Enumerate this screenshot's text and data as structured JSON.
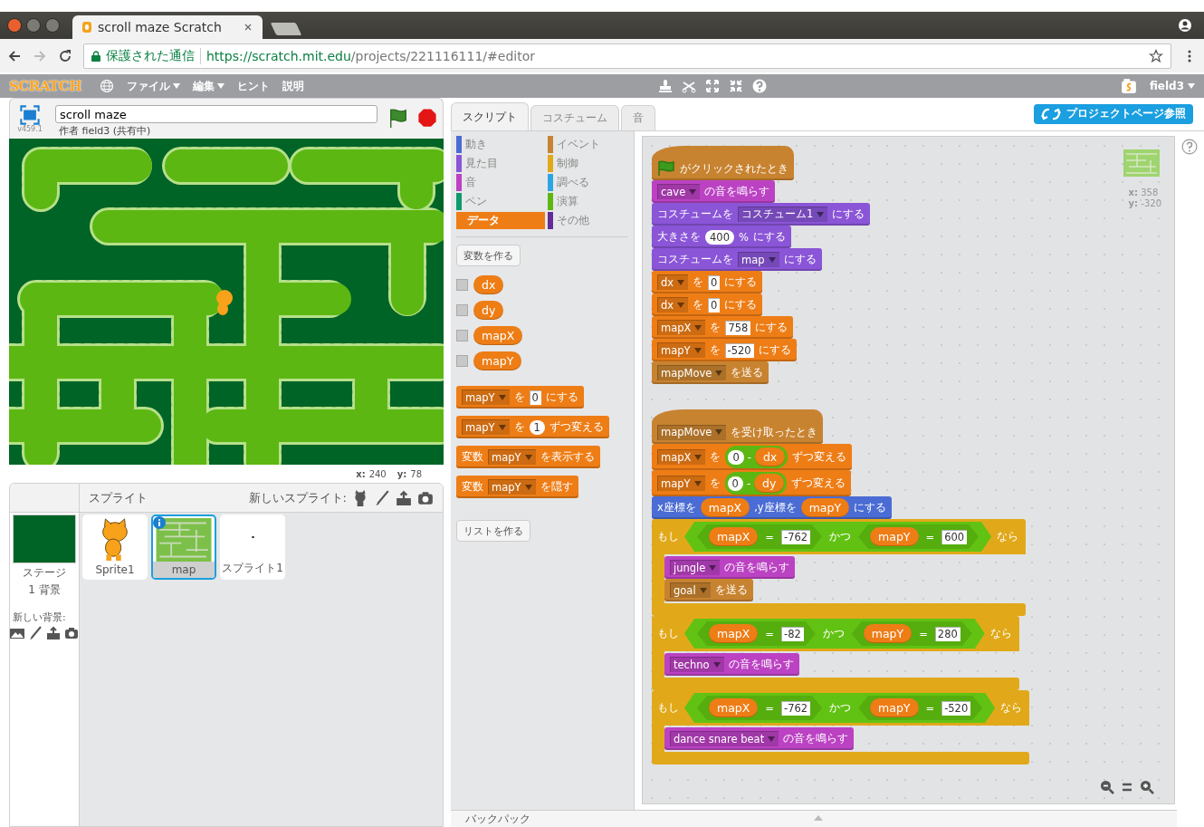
{
  "browser": {
    "tab_title": "scroll maze Scratch",
    "security_label": "保護された通信",
    "url_host": "https://scratch.mit.edu",
    "url_path": "/projects/221116111/#editor"
  },
  "menu_bar": {
    "logo": "SCRATCH",
    "items": [
      {
        "label": "ファイル",
        "has_menu": true
      },
      {
        "label": "編集",
        "has_menu": true
      },
      {
        "label": "ヒント",
        "has_menu": false
      },
      {
        "label": "説明",
        "has_menu": false
      }
    ],
    "user": "field3"
  },
  "stage": {
    "version": "v459.1",
    "title": "scroll maze",
    "author": "作者 field3 (共有中)",
    "x_label": "x:",
    "x_value": "240",
    "y_label": "y:",
    "y_value": "78"
  },
  "sprites_pane": {
    "title": "スプライト",
    "new_sprite_label": "新しいスプライト:",
    "stage_label": "ステージ",
    "backdrop_count": "1 背景",
    "new_backdrop_label": "新しい背景:",
    "sprites": [
      {
        "name": "Sprite1",
        "kind": "character",
        "selected": false
      },
      {
        "name": "map",
        "kind": "maze",
        "selected": true
      },
      {
        "name": "スプライト1",
        "kind": "dot",
        "selected": false
      }
    ]
  },
  "editor_tabs": [
    {
      "label": "スクリプト",
      "selected": true
    },
    {
      "label": "コスチューム",
      "selected": false
    },
    {
      "label": "音",
      "selected": false
    }
  ],
  "project_page_button": "プロジェクトページ参照",
  "categories": [
    {
      "label": "動き",
      "color": "#4a6cd4",
      "selected": false
    },
    {
      "label": "見た目",
      "color": "#8a55d7",
      "selected": false
    },
    {
      "label": "音",
      "color": "#bb42c3",
      "selected": false
    },
    {
      "label": "ペン",
      "color": "#0e9a6c",
      "selected": false
    },
    {
      "label": "データ",
      "color": "#ee7d16",
      "selected": true
    },
    {
      "label": "イベント",
      "color": "#c88330",
      "selected": false
    },
    {
      "label": "制御",
      "color": "#e1a91a",
      "selected": false
    },
    {
      "label": "調べる",
      "color": "#2ca5e2",
      "selected": false
    },
    {
      "label": "演算",
      "color": "#5cb712",
      "selected": false
    },
    {
      "label": "その他",
      "color": "#632d99",
      "selected": false
    }
  ],
  "palette": {
    "make_variable": "変数を作る",
    "variables": [
      {
        "name": "dx",
        "checked": false
      },
      {
        "name": "dy",
        "checked": false
      },
      {
        "name": "mapX",
        "checked": false
      },
      {
        "name": "mapY",
        "checked": false
      }
    ],
    "blocks": [
      {
        "kind": "data",
        "parts": [
          {
            "kind": "dropdown",
            "text": "mapY"
          },
          {
            "kind": "text",
            "text": "を"
          },
          {
            "kind": "number",
            "text": "0"
          },
          {
            "kind": "text",
            "text": "にする"
          }
        ]
      },
      {
        "kind": "data",
        "parts": [
          {
            "kind": "dropdown",
            "text": "mapY"
          },
          {
            "kind": "text",
            "text": "を"
          },
          {
            "kind": "round",
            "text": "1"
          },
          {
            "kind": "text",
            "text": "ずつ変える"
          }
        ]
      },
      {
        "kind": "data",
        "parts": [
          {
            "kind": "text",
            "text": "変数"
          },
          {
            "kind": "dropdown",
            "text": "mapY"
          },
          {
            "kind": "text",
            "text": "を表示する"
          }
        ]
      },
      {
        "kind": "data",
        "parts": [
          {
            "kind": "text",
            "text": "変数"
          },
          {
            "kind": "dropdown",
            "text": "mapY"
          },
          {
            "kind": "text",
            "text": "を隠す"
          }
        ]
      }
    ],
    "make_list": "リストを作る"
  },
  "scripts": [
    {
      "blocks": [
        {
          "kind": "hat",
          "parts": [
            {
              "kind": "flag"
            },
            {
              "kind": "text",
              "text": "がクリックされたとき"
            }
          ]
        },
        {
          "kind": "sound",
          "parts": [
            {
              "kind": "dropdown",
              "text": "cave"
            },
            {
              "kind": "text",
              "text": "の音を鳴らす"
            }
          ]
        },
        {
          "kind": "looks",
          "parts": [
            {
              "kind": "text",
              "text": "コスチュームを"
            },
            {
              "kind": "dropdown",
              "text": "コスチューム1"
            },
            {
              "kind": "text",
              "text": "にする"
            }
          ]
        },
        {
          "kind": "looks",
          "parts": [
            {
              "kind": "text",
              "text": "大きさを"
            },
            {
              "kind": "round",
              "text": "400"
            },
            {
              "kind": "text",
              "text": "%"
            },
            {
              "kind": "text",
              "text": "にする"
            }
          ]
        },
        {
          "kind": "looks",
          "parts": [
            {
              "kind": "text",
              "text": "コスチュームを"
            },
            {
              "kind": "dropdown",
              "text": "map"
            },
            {
              "kind": "text",
              "text": "にする"
            }
          ]
        },
        {
          "kind": "data",
          "parts": [
            {
              "kind": "dropdown",
              "text": "dx"
            },
            {
              "kind": "text",
              "text": "を"
            },
            {
              "kind": "number",
              "text": "0"
            },
            {
              "kind": "text",
              "text": "にする"
            }
          ]
        },
        {
          "kind": "data",
          "parts": [
            {
              "kind": "dropdown",
              "text": "dx"
            },
            {
              "kind": "text",
              "text": "を"
            },
            {
              "kind": "number",
              "text": "0"
            },
            {
              "kind": "text",
              "text": "にする"
            }
          ]
        },
        {
          "kind": "data",
          "parts": [
            {
              "kind": "dropdown",
              "text": "mapX"
            },
            {
              "kind": "text",
              "text": "を"
            },
            {
              "kind": "number",
              "text": "758"
            },
            {
              "kind": "text",
              "text": "にする"
            }
          ]
        },
        {
          "kind": "data",
          "parts": [
            {
              "kind": "dropdown",
              "text": "mapY"
            },
            {
              "kind": "text",
              "text": "を"
            },
            {
              "kind": "number",
              "text": "-520"
            },
            {
              "kind": "text",
              "text": "にする"
            }
          ]
        },
        {
          "kind": "event",
          "parts": [
            {
              "kind": "dropdown",
              "text": "mapMove"
            },
            {
              "kind": "text",
              "text": "を送る"
            }
          ]
        }
      ]
    },
    {
      "blocks": [
        {
          "kind": "hat",
          "parts": [
            {
              "kind": "dropdown",
              "text": "mapMove"
            },
            {
              "kind": "text",
              "text": "を受け取ったとき"
            }
          ]
        },
        {
          "kind": "data",
          "parts": [
            {
              "kind": "dropdown",
              "text": "mapX"
            },
            {
              "kind": "text",
              "text": "を"
            },
            {
              "kind": "op",
              "parts": [
                {
                  "kind": "round",
                  "text": "0"
                },
                {
                  "kind": "text",
                  "text": "-"
                },
                {
                  "kind": "var",
                  "text": "dx"
                }
              ]
            },
            {
              "kind": "text",
              "text": "ずつ変える"
            }
          ]
        },
        {
          "kind": "data",
          "parts": [
            {
              "kind": "dropdown",
              "text": "mapY"
            },
            {
              "kind": "text",
              "text": "を"
            },
            {
              "kind": "op",
              "parts": [
                {
                  "kind": "round",
                  "text": "0"
                },
                {
                  "kind": "text",
                  "text": "-"
                },
                {
                  "kind": "var",
                  "text": "dy"
                }
              ]
            },
            {
              "kind": "text",
              "text": "ずつ変える"
            }
          ]
        },
        {
          "kind": "motion",
          "parts": [
            {
              "kind": "text",
              "text": "x座標を"
            },
            {
              "kind": "var",
              "text": "mapX"
            },
            {
              "kind": "text",
              "text": ",y座標を"
            },
            {
              "kind": "var",
              "text": "mapY"
            },
            {
              "kind": "text",
              "text": "にする"
            }
          ]
        },
        {
          "kind": "control",
          "parts": [
            {
              "kind": "text",
              "text": "もし"
            },
            {
              "kind": "bool",
              "parts": [
                {
                  "kind": "bool",
                  "parts": [
                    {
                      "kind": "var",
                      "text": "mapX"
                    },
                    {
                      "kind": "text",
                      "text": "="
                    },
                    {
                      "kind": "number",
                      "text": "-762"
                    }
                  ]
                },
                {
                  "kind": "text",
                  "text": "かつ"
                },
                {
                  "kind": "bool",
                  "parts": [
                    {
                      "kind": "var",
                      "text": "mapY"
                    },
                    {
                      "kind": "text",
                      "text": "="
                    },
                    {
                      "kind": "number",
                      "text": "600"
                    }
                  ]
                }
              ]
            },
            {
              "kind": "text",
              "text": "なら"
            }
          ],
          "children": [
            {
              "kind": "sound",
              "parts": [
                {
                  "kind": "dropdown",
                  "text": "jungle"
                },
                {
                  "kind": "text",
                  "text": "の音を鳴らす"
                }
              ]
            },
            {
              "kind": "event",
              "parts": [
                {
                  "kind": "dropdown",
                  "text": "goal"
                },
                {
                  "kind": "text",
                  "text": "を送る"
                }
              ]
            }
          ]
        },
        {
          "kind": "control",
          "parts": [
            {
              "kind": "text",
              "text": "もし"
            },
            {
              "kind": "bool",
              "parts": [
                {
                  "kind": "bool",
                  "parts": [
                    {
                      "kind": "var",
                      "text": "mapX"
                    },
                    {
                      "kind": "text",
                      "text": "="
                    },
                    {
                      "kind": "number",
                      "text": "-82"
                    }
                  ]
                },
                {
                  "kind": "text",
                  "text": "かつ"
                },
                {
                  "kind": "bool",
                  "parts": [
                    {
                      "kind": "var",
                      "text": "mapY"
                    },
                    {
                      "kind": "text",
                      "text": "="
                    },
                    {
                      "kind": "number",
                      "text": "280"
                    }
                  ]
                }
              ]
            },
            {
              "kind": "text",
              "text": "なら"
            }
          ],
          "children": [
            {
              "kind": "sound",
              "parts": [
                {
                  "kind": "dropdown",
                  "text": "techno"
                },
                {
                  "kind": "text",
                  "text": "の音を鳴らす"
                }
              ]
            }
          ]
        },
        {
          "kind": "control",
          "parts": [
            {
              "kind": "text",
              "text": "もし"
            },
            {
              "kind": "bool",
              "parts": [
                {
                  "kind": "bool",
                  "parts": [
                    {
                      "kind": "var",
                      "text": "mapX"
                    },
                    {
                      "kind": "text",
                      "text": "="
                    },
                    {
                      "kind": "number",
                      "text": "-762"
                    }
                  ]
                },
                {
                  "kind": "text",
                  "text": "かつ"
                },
                {
                  "kind": "bool",
                  "parts": [
                    {
                      "kind": "var",
                      "text": "mapY"
                    },
                    {
                      "kind": "text",
                      "text": "="
                    },
                    {
                      "kind": "number",
                      "text": "-520"
                    }
                  ]
                }
              ]
            },
            {
              "kind": "text",
              "text": "なら"
            }
          ],
          "children": [
            {
              "kind": "sound",
              "parts": [
                {
                  "kind": "dropdown",
                  "text": "dance snare beat"
                },
                {
                  "kind": "text",
                  "text": "の音を鳴らす"
                }
              ]
            }
          ]
        }
      ]
    }
  ],
  "script_coords": {
    "x_label": "x:",
    "x_value": "358",
    "y_label": "y:",
    "y_value": "-320"
  },
  "backpack": "バックパック"
}
